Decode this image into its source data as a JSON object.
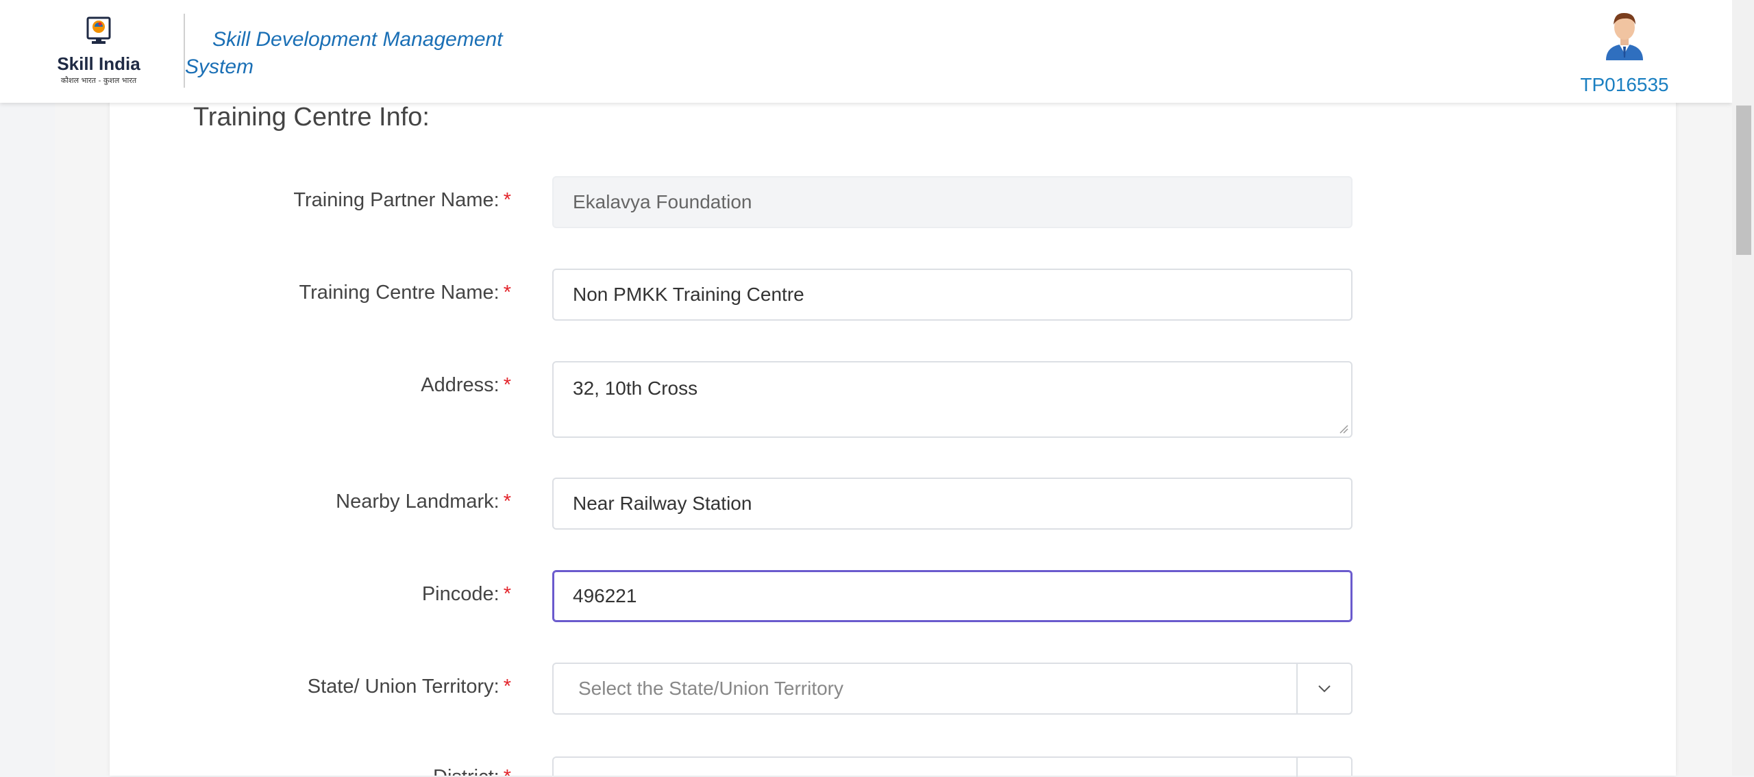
{
  "header": {
    "logo_main": "Skill India",
    "logo_sub": "कौशल भारत - कुशल भारत",
    "app_title": "Skill Development Management System",
    "user_id": "TP016535"
  },
  "form": {
    "section_title": "Training Centre Info:",
    "required_marker": "*",
    "fields": [
      {
        "label": "Training Partner Name:",
        "value": "Ekalavya Foundation"
      },
      {
        "label": "Training Centre Name:",
        "value": "Non PMKK Training Centre"
      },
      {
        "label": "Address:",
        "value": "32, 10th Cross"
      },
      {
        "label": "Nearby Landmark:",
        "value": "Near Railway Station"
      },
      {
        "label": "Pincode:",
        "value": "496221"
      },
      {
        "label": "State/ Union Territory:",
        "placeholder": "Select the State/Union Territory"
      },
      {
        "label": "District:"
      }
    ]
  },
  "colors": {
    "accent": "#1a6fb5",
    "required": "#e3242b",
    "focus_border": "#6a5acd"
  },
  "icons": {
    "select_toggle": "chevron-down-icon",
    "profile": "avatar-icon"
  }
}
